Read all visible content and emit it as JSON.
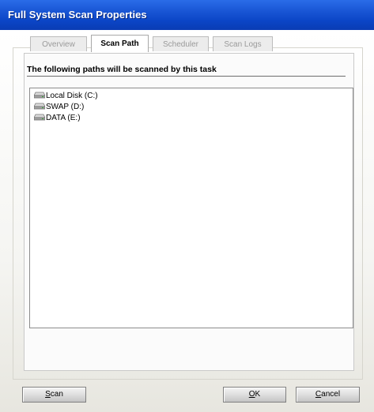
{
  "window": {
    "title": "Full System Scan Properties"
  },
  "tabs": [
    {
      "label": "Overview",
      "active": false
    },
    {
      "label": "Scan Path",
      "active": true
    },
    {
      "label": "Scheduler",
      "active": false
    },
    {
      "label": "Scan Logs",
      "active": false
    }
  ],
  "scan_path": {
    "section_label": "The following paths will be scanned by this task",
    "paths": [
      {
        "label": "Local Disk (C:)",
        "icon": "drive-icon"
      },
      {
        "label": "SWAP (D:)",
        "icon": "drive-icon"
      },
      {
        "label": "DATA (E:)",
        "icon": "drive-icon"
      }
    ]
  },
  "buttons": {
    "scan": {
      "first": "S",
      "rest": "can"
    },
    "ok": {
      "first": "O",
      "rest": "K"
    },
    "cancel": {
      "first": "C",
      "rest": "ancel"
    }
  },
  "colors": {
    "titlebar": "#0b45c6",
    "title_text": "#ffffff",
    "inactive_tab_text": "#9a9a9a"
  }
}
